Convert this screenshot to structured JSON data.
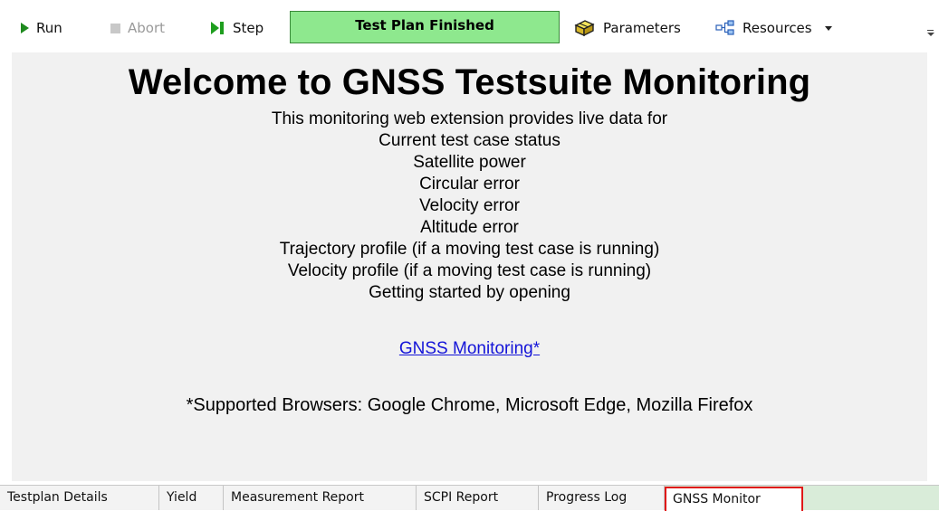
{
  "toolbar": {
    "run_label": "Run",
    "abort_label": "Abort",
    "step_label": "Step",
    "status_text": "Test Plan Finished",
    "parameters_label": "Parameters",
    "resources_label": "Resources",
    "status_color": "#8ee88e",
    "run_icon": "play-icon",
    "abort_icon": "stop-icon",
    "step_icon": "step-icon",
    "parameters_icon": "cube-icon",
    "resources_icon": "network-icon"
  },
  "content": {
    "title": "Welcome to GNSS Testsuite Monitoring",
    "intro": "This monitoring web extension provides live data for",
    "features": [
      "Current test case status",
      "Satellite power",
      "Circular error",
      "Velocity error",
      "Altitude error",
      "Trajectory profile (if a moving test case is running)",
      "Velocity profile (if a moving test case is running)"
    ],
    "getting_started": "Getting started by opening",
    "link_text": "GNSS Monitoring*",
    "browsers_note": "*Supported Browsers: Google Chrome, Microsoft Edge, Mozilla Firefox",
    "link_color": "#1414d8"
  },
  "tabs": [
    {
      "label": "Testplan Details"
    },
    {
      "label": "Yield"
    },
    {
      "label": "Measurement Report"
    },
    {
      "label": "SCPI Report"
    },
    {
      "label": "Progress Log"
    },
    {
      "label": "GNSS Monitor",
      "active": true
    }
  ],
  "active_tab_border_color": "#e01818"
}
